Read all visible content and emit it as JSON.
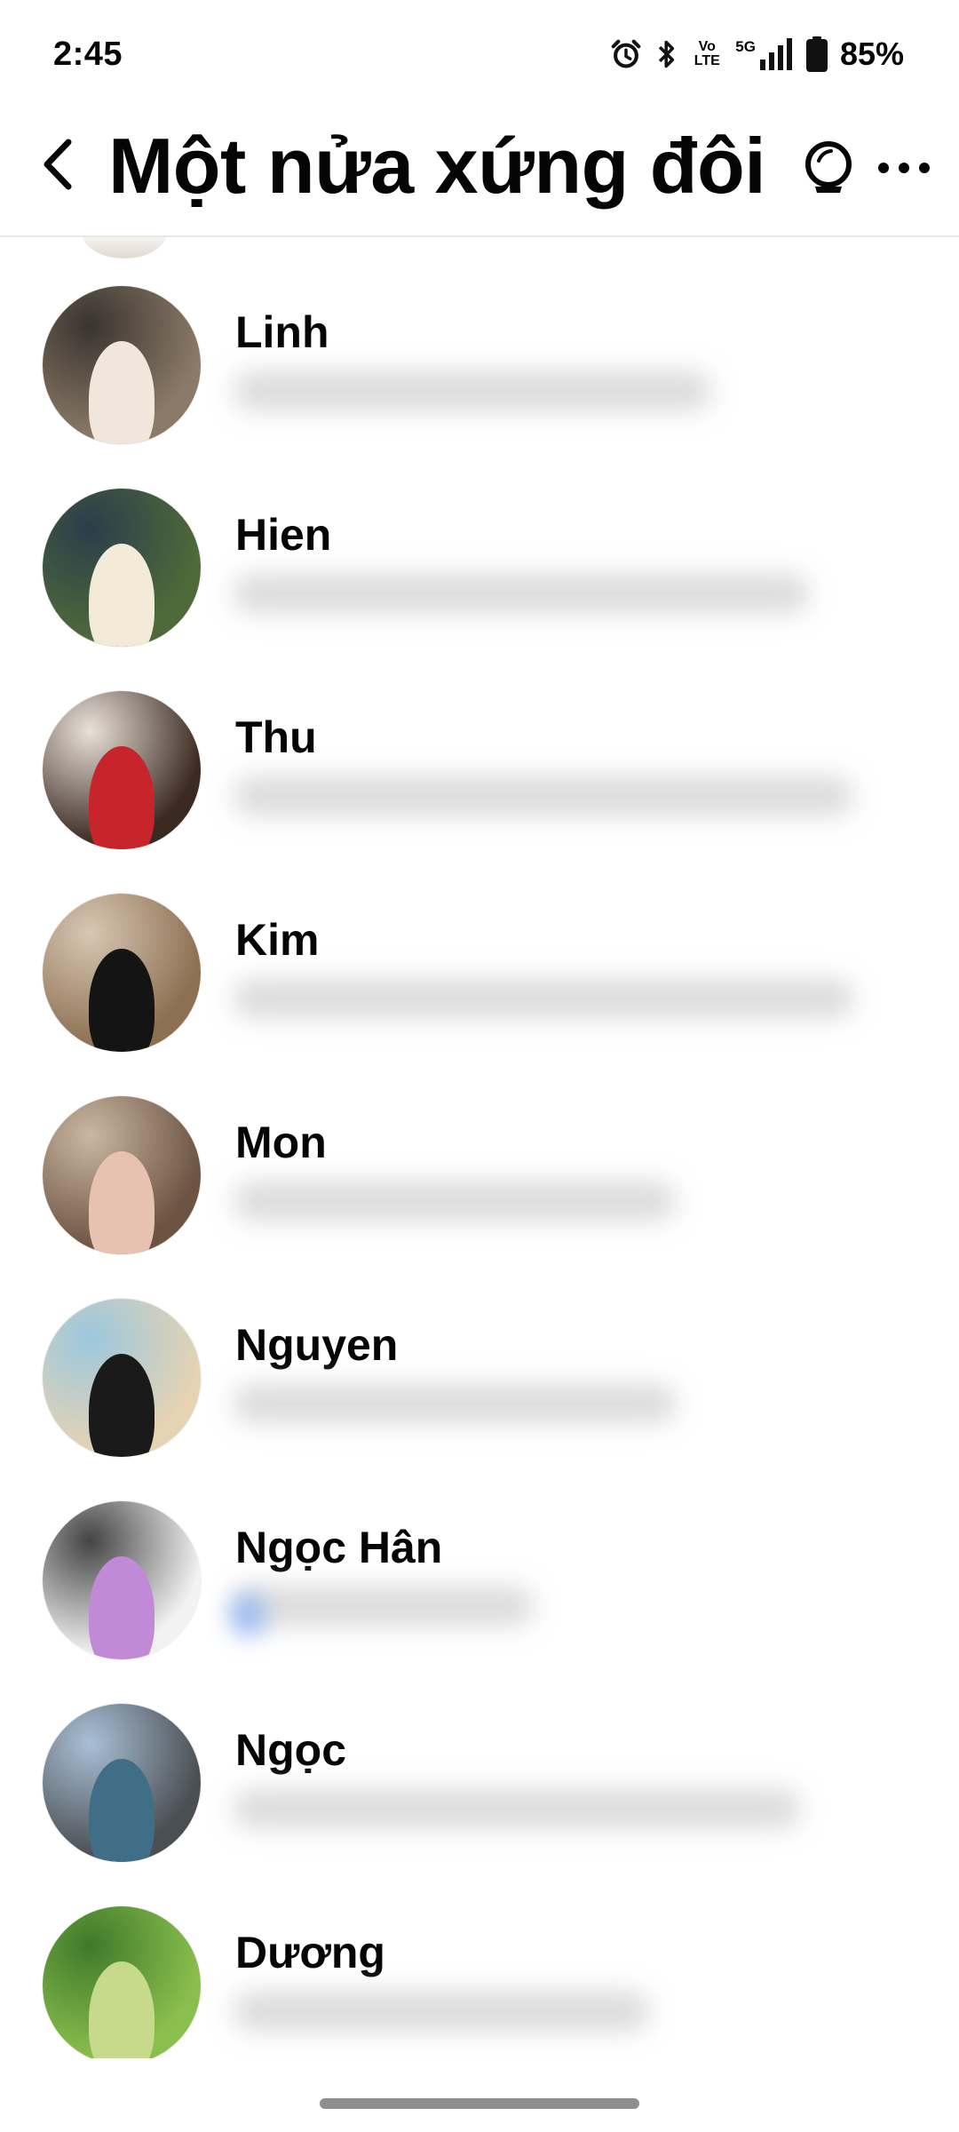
{
  "status_bar": {
    "time": "2:45",
    "volte_line1": "Vo",
    "volte_line2": "LTE",
    "network": "5G",
    "battery": "85%"
  },
  "header": {
    "title": "Một nửa xứng đôi",
    "icons": [
      "chevron-left-icon",
      "ai-bubble-icon",
      "more-icon"
    ]
  },
  "contacts": [
    {
      "name": "Linh",
      "preview_blurred": true,
      "avatar_colors": [
        "#3a342f",
        "#8b7a68",
        "#f1e6dc"
      ]
    },
    {
      "name": "Hien",
      "preview_blurred": true,
      "avatar_colors": [
        "#2c3d4b",
        "#4f6a3a",
        "#f4ead8"
      ]
    },
    {
      "name": "Thu",
      "preview_blurred": true,
      "avatar_colors": [
        "#e9e1d8",
        "#3b2a22",
        "#c8242c"
      ]
    },
    {
      "name": "Kim",
      "preview_blurred": true,
      "avatar_colors": [
        "#d7c7b3",
        "#8d6f52",
        "#141414"
      ]
    },
    {
      "name": "Mon",
      "preview_blurred": true,
      "avatar_colors": [
        "#c9b7a3",
        "#6d5442",
        "#e8c2b0"
      ]
    },
    {
      "name": "Nguyen",
      "preview_blurred": true,
      "avatar_colors": [
        "#9cc7dd",
        "#e5d3b3",
        "#1a1a1a"
      ]
    },
    {
      "name": "Ngọc Hân",
      "preview_blurred": true,
      "avatar_colors": [
        "#444444",
        "#f2f2f2",
        "#c08ad6"
      ]
    },
    {
      "name": "Ngọc",
      "preview_blurred": true,
      "avatar_colors": [
        "#a9bfd6",
        "#4a4f53",
        "#3f6e86"
      ]
    },
    {
      "name": "Dương",
      "preview_blurred": true,
      "avatar_colors": [
        "#3f7a2a",
        "#8bbf4d",
        "#c7d98a"
      ]
    }
  ]
}
